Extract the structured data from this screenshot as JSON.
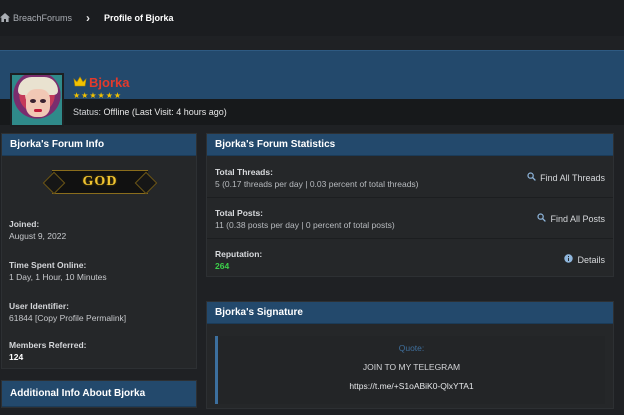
{
  "breadcrumb": {
    "home_icon": "home-icon",
    "home_label": "BreachForums",
    "separator": "›",
    "current": "Profile of Bjorka"
  },
  "profile": {
    "username": "Bjorka",
    "crown_icon": "crown-icon",
    "stars": "★★★★★★",
    "status_label": "Status:",
    "status_value": "Offline (Last Visit: 4 hours ago)"
  },
  "forum_info": {
    "title": "Bjorka's Forum Info",
    "rank_badge": "GOD",
    "joined_label": "Joined:",
    "joined_value": "August 9, 2022",
    "time_online_label": "Time Spent Online:",
    "time_online_value": "1 Day, 1 Hour, 10 Minutes",
    "user_id_label": "User Identifier:",
    "user_id_value": "61844 [Copy Profile Permalink]",
    "referred_label": "Members Referred:",
    "referred_value": "124"
  },
  "additional_info": {
    "title": "Additional Info About Bjorka"
  },
  "forum_stats": {
    "title": "Bjorka's Forum Statistics",
    "threads_label": "Total Threads:",
    "threads_value": "5 (0.17 threads per day | 0.03 percent of total threads)",
    "threads_action": "Find All Threads",
    "posts_label": "Total Posts:",
    "posts_value": "11 (0.38 posts per day | 0 percent of total posts)",
    "posts_action": "Find All Posts",
    "reputation_label": "Reputation:",
    "reputation_value": "264",
    "reputation_action": "Details"
  },
  "signature": {
    "title": "Bjorka's Signature",
    "quote_label": "Quote:",
    "line1": "JOIN TO MY TELEGRAM",
    "link": "https://t.me/+S1oABiK0-QlxYTA1"
  },
  "colors": {
    "accent": "#23496c",
    "username": "#e23a2c",
    "reputation": "#3ccf4a",
    "rank_gold": "#f0c431"
  }
}
